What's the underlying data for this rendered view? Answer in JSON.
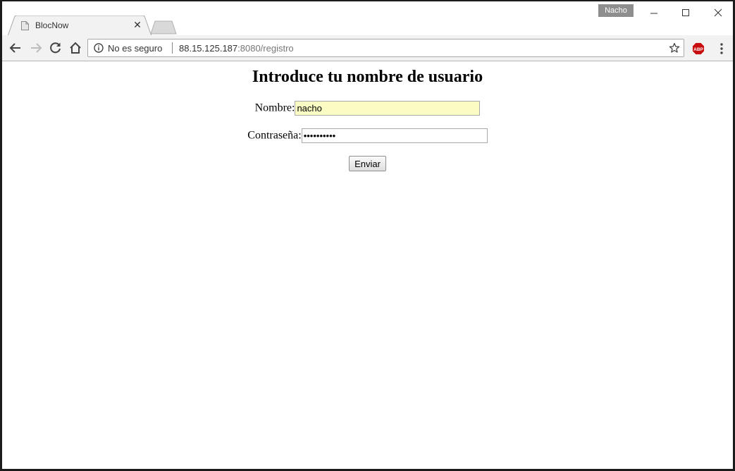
{
  "browser": {
    "tab": {
      "title": "BlocNow",
      "close_glyph": "✕",
      "favicon": "page-icon"
    },
    "profile_name": "Nacho",
    "window_controls": [
      "minimize-icon",
      "maximize-icon",
      "close-icon"
    ],
    "address_bar": {
      "security_text": "No es seguro",
      "url_host": "88.15.125.187",
      "url_rest": ":8080/registro"
    },
    "extension": "ABP"
  },
  "page": {
    "heading": "Introduce tu nombre de usuario",
    "form": {
      "name_label": "Nombre:",
      "name_value": "nacho",
      "password_label": "Contraseña:",
      "password_value": "••••••••••",
      "submit_label": "Enviar"
    }
  }
}
